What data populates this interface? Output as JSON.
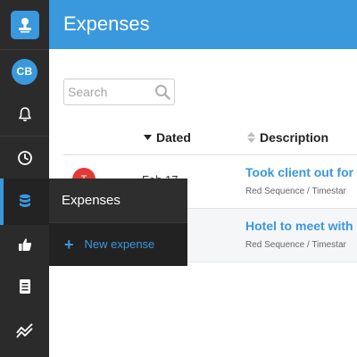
{
  "header": {
    "title": "Expenses"
  },
  "user": {
    "initials": "CB"
  },
  "search": {
    "placeholder": "Search",
    "value": ""
  },
  "table": {
    "columns": {
      "dated": "Dated",
      "description": "Description"
    },
    "rows": [
      {
        "avatar": "T",
        "date": "Feb 17",
        "title": "Took client out for",
        "subtitle": "Red Sequence / Timestar"
      },
      {
        "avatar": "",
        "date": "",
        "title": "Hotel to meet with",
        "subtitle": "Red Sequence / Timestar"
      }
    ]
  },
  "flyout": {
    "title": "Expenses",
    "new_label": "New expense",
    "plus": "+"
  },
  "colors": {
    "accent": "#3a98dd",
    "sidebar": "#2b2b2b",
    "flyout": "#222222",
    "avatar_red": "#e53935"
  },
  "icons": [
    "logo-icon",
    "bell-icon",
    "clock-icon",
    "database-icon",
    "thumbs-up-icon",
    "document-icon",
    "chart-icon",
    "search-icon"
  ]
}
